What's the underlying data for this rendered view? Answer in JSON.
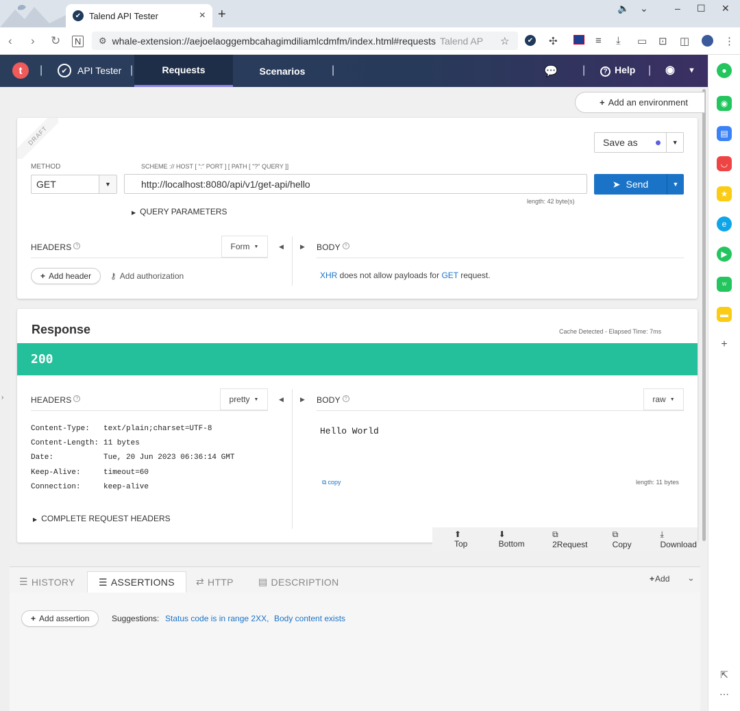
{
  "browser": {
    "tab_title": "Talend API Tester",
    "url": "whale-extension://aejoelaoggembcahagimdiliamlcdmfm/index.html#requests",
    "title_suffix": "Talend AP"
  },
  "app": {
    "logo_letter": "t",
    "name": "API Tester",
    "nav": [
      {
        "label": "Requests",
        "active": true
      },
      {
        "label": "Scenarios",
        "active": false
      }
    ],
    "help_label": "Help"
  },
  "environment": {
    "add_label": "Add an environment"
  },
  "request": {
    "draft_label": "DRAFT",
    "save_as_label": "Save as",
    "method_label": "METHOD",
    "method_value": "GET",
    "scheme_hint": "SCHEME :// HOST [ \":\" PORT ] [ PATH [ \"?\" QUERY ]]",
    "url_value": "http://localhost:8080/api/v1/get-api/hello",
    "length_text": "length: 42 byte(s)",
    "send_label": "Send",
    "query_params_label": "QUERY PARAMETERS",
    "headers_label": "HEADERS",
    "headers_mode": "Form",
    "body_label": "BODY",
    "add_header_label": "Add header",
    "add_auth_label": "Add authorization",
    "body_note_xhr": "XHR",
    "body_note_mid": " does not allow payloads for ",
    "body_note_method": "GET",
    "body_note_end": " request."
  },
  "response": {
    "title": "Response",
    "meta": "Cache Detected - Elapsed Time: 7ms",
    "status_code": "200",
    "status_color": "#23c09b",
    "headers_label": "HEADERS",
    "headers_mode": "pretty",
    "body_label": "BODY",
    "body_mode": "raw",
    "headers": [
      {
        "key": "Content-Type:",
        "value": "text/plain;charset=UTF-8"
      },
      {
        "key": "Content-Length:",
        "value": "11 bytes"
      },
      {
        "key": "Date:",
        "value": "Tue, 20 Jun 2023 06:36:14 GMT"
      },
      {
        "key": "Keep-Alive:",
        "value": "timeout=60"
      },
      {
        "key": "Connection:",
        "value": "keep-alive"
      }
    ],
    "body_text": "Hello World",
    "copy_label": "copy",
    "body_length": "length: 11 bytes",
    "complete_headers_label": "COMPLETE REQUEST HEADERS",
    "actions": [
      "Top",
      "Bottom",
      "2Request",
      "Copy",
      "Download"
    ]
  },
  "bottom": {
    "tabs": [
      {
        "label": "HISTORY",
        "active": false
      },
      {
        "label": "ASSERTIONS",
        "active": true
      },
      {
        "label": "HTTP",
        "active": false
      },
      {
        "label": "DESCRIPTION",
        "active": false
      }
    ],
    "add_label": "Add",
    "add_assertion_label": "Add assertion",
    "suggestions_label": "Suggestions:",
    "suggestions": [
      "Status code is in range 2XX,",
      "Body content exists"
    ]
  }
}
